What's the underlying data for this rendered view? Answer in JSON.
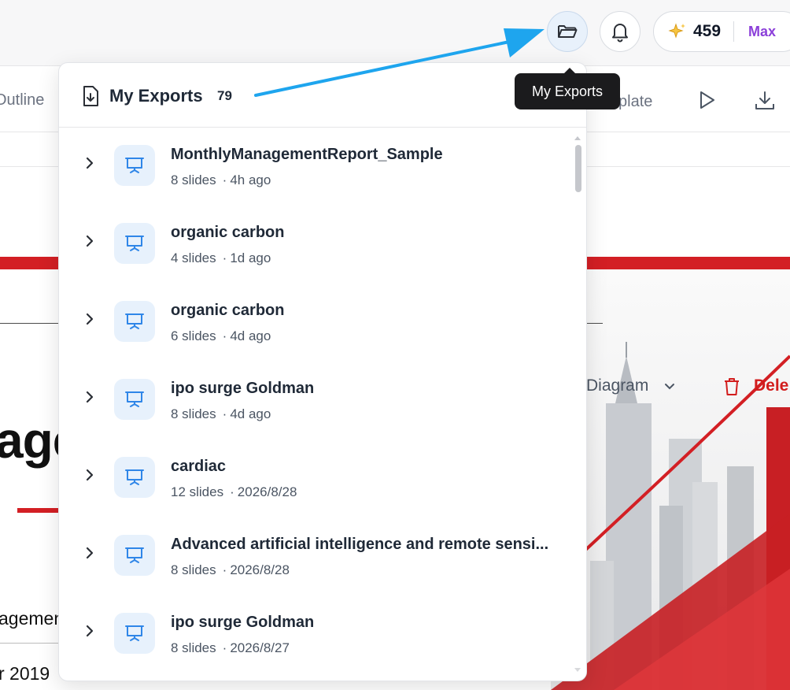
{
  "header": {
    "exports_button_label": "My Exports",
    "credits": "459",
    "plan": "Max"
  },
  "toolbar": {
    "outline_partial": "Outline",
    "template_partial": "plate",
    "diagram_label": "Diagram",
    "delete_partial": "Dele"
  },
  "slide": {
    "title_partial": "agem",
    "subtitle_partial": "agemen",
    "date_partial": "r 2019"
  },
  "exports_panel": {
    "title": "My Exports",
    "count": "79",
    "items": [
      {
        "name": "MonthlyManagementReport_Sample",
        "slides": "8 slides",
        "time": "4h ago"
      },
      {
        "name": "organic carbon",
        "slides": "4 slides",
        "time": "1d ago"
      },
      {
        "name": "organic carbon",
        "slides": "6 slides",
        "time": "4d ago"
      },
      {
        "name": "ipo surge Goldman",
        "slides": "8 slides",
        "time": "4d ago"
      },
      {
        "name": "cardiac",
        "slides": "12 slides",
        "time": "2026/8/28"
      },
      {
        "name": "Advanced artificial intelligence and remote sensi...",
        "slides": "8 slides",
        "time": "2026/8/28"
      },
      {
        "name": "ipo surge Goldman",
        "slides": "8 slides",
        "time": "2026/8/27"
      }
    ]
  },
  "tooltip": {
    "text": "My Exports"
  },
  "colors": {
    "accent_blue": "#2f86e8",
    "arrow_blue": "#1ea5ee",
    "brand_red": "#d31f24",
    "plan_purple": "#8b3fd9"
  }
}
